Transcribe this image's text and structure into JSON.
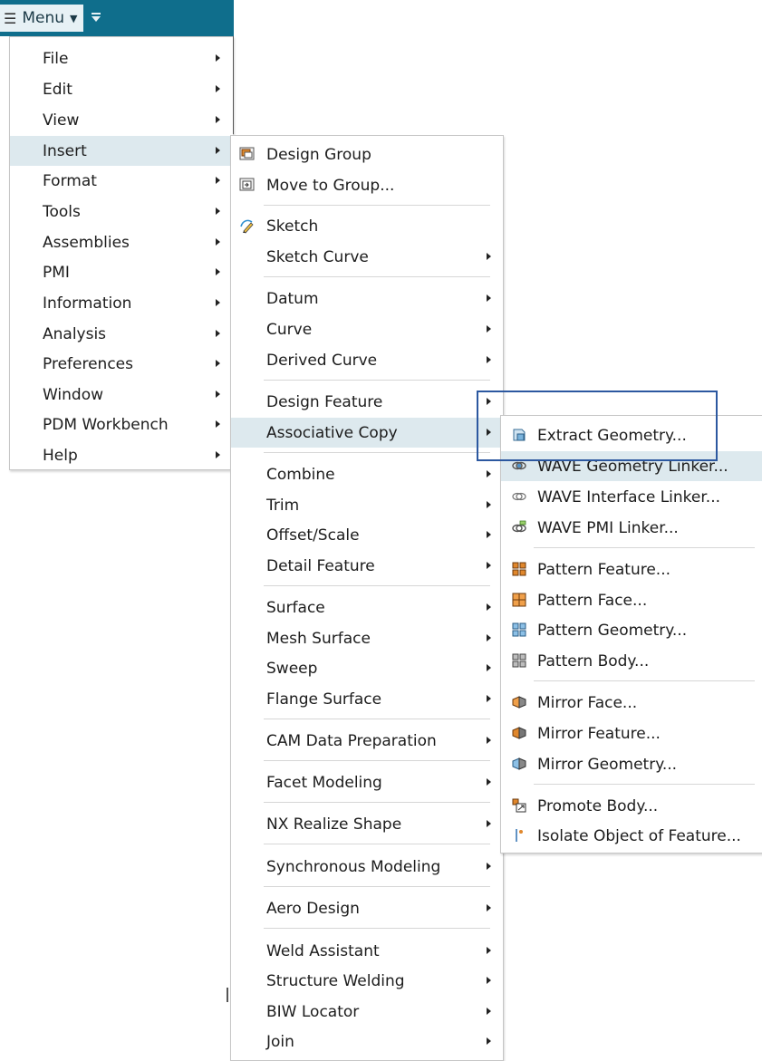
{
  "menubar": {
    "menu_label": "Menu"
  },
  "main_menu": {
    "items": [
      {
        "label": "File",
        "highlighted": false
      },
      {
        "label": "Edit",
        "highlighted": false
      },
      {
        "label": "View",
        "highlighted": false
      },
      {
        "label": "Insert",
        "highlighted": true
      },
      {
        "label": "Format",
        "highlighted": false
      },
      {
        "label": "Tools",
        "highlighted": false
      },
      {
        "label": "Assemblies",
        "highlighted": false
      },
      {
        "label": "PMI",
        "highlighted": false
      },
      {
        "label": "Information",
        "highlighted": false
      },
      {
        "label": "Analysis",
        "highlighted": false
      },
      {
        "label": "Preferences",
        "highlighted": false
      },
      {
        "label": "Window",
        "highlighted": false
      },
      {
        "label": "PDM Workbench",
        "highlighted": false
      },
      {
        "label": "Help",
        "highlighted": false
      }
    ]
  },
  "insert_menu": {
    "items": [
      {
        "label": "Design Group",
        "icon": "design-group-icon",
        "submenu": false
      },
      {
        "label": "Move to Group...",
        "icon": "move-to-group-icon",
        "submenu": false
      },
      {
        "label": "Sketch",
        "icon": "sketch-icon",
        "submenu": false
      },
      {
        "label": "Sketch Curve",
        "submenu": true
      },
      {
        "label": "Datum",
        "submenu": true
      },
      {
        "label": "Curve",
        "submenu": true
      },
      {
        "label": "Derived Curve",
        "submenu": true
      },
      {
        "label": "Design Feature",
        "submenu": true
      },
      {
        "label": "Associative Copy",
        "submenu": true,
        "highlighted": true
      },
      {
        "label": "Combine",
        "submenu": true
      },
      {
        "label": "Trim",
        "submenu": true
      },
      {
        "label": "Offset/Scale",
        "submenu": true
      },
      {
        "label": "Detail Feature",
        "submenu": true
      },
      {
        "label": "Surface",
        "submenu": true
      },
      {
        "label": "Mesh Surface",
        "submenu": true
      },
      {
        "label": "Sweep",
        "submenu": true
      },
      {
        "label": "Flange Surface",
        "submenu": true
      },
      {
        "label": "CAM Data Preparation",
        "submenu": true
      },
      {
        "label": "Facet Modeling",
        "submenu": true
      },
      {
        "label": "NX Realize Shape",
        "submenu": true
      },
      {
        "label": "Synchronous Modeling",
        "submenu": true
      },
      {
        "label": "Aero Design",
        "submenu": true
      },
      {
        "label": "Weld Assistant",
        "submenu": true
      },
      {
        "label": "Structure Welding",
        "submenu": true
      },
      {
        "label": "BIW Locator",
        "submenu": true
      },
      {
        "label": "Join",
        "submenu": true
      }
    ]
  },
  "associative_copy_menu": {
    "items": [
      {
        "label": "Extract Geometry...",
        "icon": "extract-geometry-icon"
      },
      {
        "label": "WAVE Geometry Linker...",
        "icon": "wave-geometry-linker-icon",
        "highlighted": true
      },
      {
        "label": "WAVE Interface Linker...",
        "icon": "wave-interface-linker-icon"
      },
      {
        "label": "WAVE PMI Linker...",
        "icon": "wave-pmi-linker-icon"
      },
      {
        "label": "Pattern Feature...",
        "icon": "pattern-feature-icon"
      },
      {
        "label": "Pattern Face...",
        "icon": "pattern-face-icon"
      },
      {
        "label": "Pattern Geometry...",
        "icon": "pattern-geometry-icon"
      },
      {
        "label": "Pattern Body...",
        "icon": "pattern-body-icon"
      },
      {
        "label": "Mirror Face...",
        "icon": "mirror-face-icon"
      },
      {
        "label": "Mirror Feature...",
        "icon": "mirror-feature-icon"
      },
      {
        "label": "Mirror Geometry...",
        "icon": "mirror-geometry-icon"
      },
      {
        "label": "Promote Body...",
        "icon": "promote-body-icon"
      },
      {
        "label": "Isolate Object of Feature...",
        "icon": "isolate-object-icon"
      }
    ]
  },
  "colors": {
    "menubar": "#0f6e8c",
    "highlight": "#dde9ee",
    "focus_rect": "#2c58a0"
  }
}
